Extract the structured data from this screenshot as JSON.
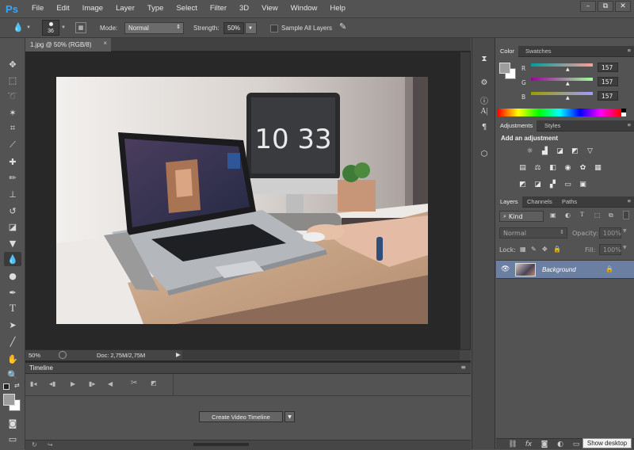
{
  "app": {
    "logo": "Ps"
  },
  "menu": [
    "File",
    "Edit",
    "Image",
    "Layer",
    "Type",
    "Select",
    "Filter",
    "3D",
    "View",
    "Window",
    "Help"
  ],
  "window_controls": {
    "minimize": "–",
    "restore": "⧉",
    "close": "✕"
  },
  "options": {
    "brush_size": "36",
    "mode_label": "Mode:",
    "mode_value": "Normal",
    "strength_label": "Strength:",
    "strength_value": "50%",
    "sample_all_layers": "Sample All Layers"
  },
  "document": {
    "tab_title": "1.jpg @ 50% (RGB/8)",
    "tab_close": "×",
    "zoom": "50%",
    "doc_info": "Doc: 2,75M/2,75M"
  },
  "timeline": {
    "title": "Timeline",
    "create_button": "Create Video Timeline"
  },
  "color_panel": {
    "tabs": [
      "Color",
      "Swatches"
    ],
    "channels": [
      {
        "name": "R",
        "value": "157"
      },
      {
        "name": "G",
        "value": "157"
      },
      {
        "name": "B",
        "value": "157"
      }
    ],
    "foreground": "#9d9d9d"
  },
  "adjustments_panel": {
    "tabs": [
      "Adjustments",
      "Styles"
    ],
    "title": "Add an adjustment"
  },
  "layers_panel": {
    "tabs": [
      "Layers",
      "Channels",
      "Paths"
    ],
    "filter_kind": "Kind",
    "blend_mode": "Normal",
    "opacity_label": "Opacity:",
    "opacity_value": "100%",
    "lock_label": "Lock:",
    "fill_label": "Fill:",
    "fill_value": "100%",
    "layers": [
      {
        "name": "Background",
        "visible": true,
        "locked": true
      }
    ]
  },
  "tooltip": "Show desktop",
  "photo": {
    "clock_text": "10 33"
  },
  "colors": {
    "accent": "#31a8ff",
    "ui_bg": "#535353",
    "canvas_bg": "#282828"
  }
}
